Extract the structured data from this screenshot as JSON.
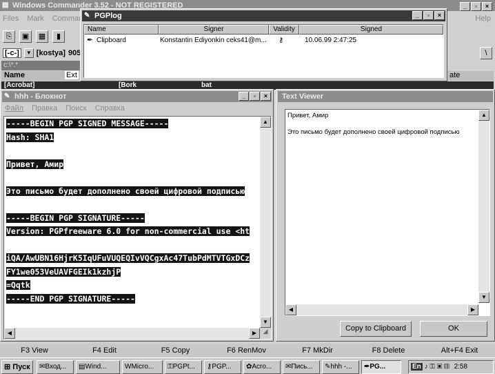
{
  "wc": {
    "title": "Windows Commander 3.52 - NOT REGISTERED",
    "menu": [
      "Files",
      "Mark",
      "Commands"
    ],
    "help": "Help",
    "drive": "[-c-]",
    "volume": "[kostya]",
    "free_text": "905",
    "path": "c:\\*.*",
    "col_name": "Name",
    "col_ext": "Ext",
    "col_date": "ate",
    "row_left_name": "[Acrobat]",
    "row_mid_name": "[Bork",
    "row_right_ext": "bat",
    "fkeys": [
      "F3 View",
      "F4 Edit",
      "F5 Copy",
      "F6 RenMov",
      "F7 MkDir",
      "F8 Delete",
      "Alt+F4 Exit"
    ]
  },
  "pgplog": {
    "title": "PGPlog",
    "columns": [
      "Name",
      "Signer",
      "Validity",
      "Signed"
    ],
    "row": {
      "name": "Clipboard",
      "signer": "Konstantin Ediyonkin ceks41@m...",
      "signed": "10.06.99 2:47:25"
    }
  },
  "notepad": {
    "title": "hhh - Блокнот",
    "menu": [
      "Файл",
      "Правка",
      "Поиск",
      "Справка"
    ],
    "lines": [
      "-----BEGIN PGP SIGNED MESSAGE-----",
      "Hash: SHA1",
      "",
      "Привет, Амир",
      "",
      "Это письмо будет дополнено своей цифровой подписью",
      "",
      "-----BEGIN PGP SIGNATURE-----",
      "Version: PGPfreeware 6.0 for non-commercial use <ht",
      "",
      "iQA/AwUBN16HjrK5IqUFuVUQEQIvVQCgxAc47TubPdMTVTGxDCz",
      "FY1we053VeUAVFGEIk1kzhjP",
      "=Qqtk",
      "-----END PGP SIGNATURE-----"
    ]
  },
  "viewer": {
    "title": "Text Viewer",
    "lines": [
      "Привет, Амир",
      "",
      "Это письмо будет дополнено своей цифровой подписью"
    ],
    "copy_button": "Copy to Clipboard",
    "ok_button": "OK"
  },
  "taskbar": {
    "start": "Пуск",
    "tasks": [
      "Вход...",
      "Wind...",
      "Micro...",
      "PGPt...",
      "PGP...",
      "Acro...",
      "Пись...",
      "hhh -...",
      "PG..."
    ],
    "lang": "En",
    "clock": "2:58"
  }
}
